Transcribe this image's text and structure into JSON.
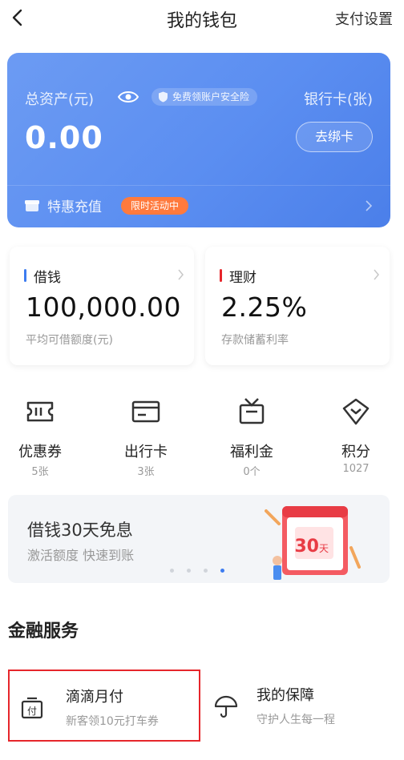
{
  "header": {
    "title": "我的钱包",
    "right_action": "支付设置"
  },
  "asset_card": {
    "asset_label": "总资产(元)",
    "asset_value": "0.00",
    "insurance_badge": "免费领账户安全险",
    "bank_label": "银行卡(张)",
    "bind_button": "去绑卡",
    "recharge_label": "特惠充值",
    "promo_badge": "限时活动中"
  },
  "loan_card": {
    "title": "借钱",
    "value": "100,000.00",
    "subtitle": "平均可借额度(元)",
    "accent": "#3d7cf0"
  },
  "finance_card": {
    "title": "理财",
    "value": "2.25%",
    "subtitle": "存款储蓄利率",
    "accent": "#e6262b"
  },
  "quick_entries": [
    {
      "label": "优惠券",
      "count": "5张",
      "icon": "coupon-icon"
    },
    {
      "label": "出行卡",
      "count": "3张",
      "icon": "travel-card-icon"
    },
    {
      "label": "福利金",
      "count": "0个",
      "icon": "welfare-icon"
    },
    {
      "label": "积分",
      "count": "1027",
      "icon": "points-icon"
    }
  ],
  "banner": {
    "title": "借钱30天免息",
    "subtitle": "激活额度 快速到账",
    "calendar_number": "30",
    "calendar_unit": "天",
    "dots_total": 4,
    "active_dot": 4
  },
  "finance_services": {
    "section_title": "金融服务",
    "items": [
      {
        "title": "滴滴月付",
        "subtitle": "新客领10元打车券",
        "icon": "monthly-pay-icon"
      },
      {
        "title": "我的保障",
        "subtitle": "守护人生每一程",
        "icon": "umbrella-icon"
      }
    ]
  },
  "colors": {
    "card_blue": "#5b8ef1",
    "promo_orange": "#ff7a3d",
    "highlight_red": "#e6262b",
    "dot_active": "#3d7cf0"
  }
}
